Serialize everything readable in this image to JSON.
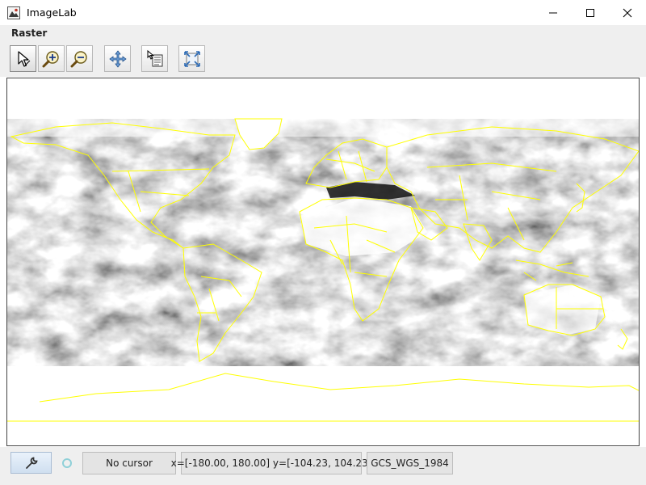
{
  "window": {
    "title": "ImageLab"
  },
  "menu": {
    "items": [
      "Raster"
    ]
  },
  "toolbar": {
    "buttons": [
      {
        "name": "select-tool",
        "icon": "select-pointer-icon"
      },
      {
        "name": "zoom-in",
        "icon": "zoom-in-icon"
      },
      {
        "name": "zoom-out",
        "icon": "zoom-out-icon"
      },
      {
        "name": "pan",
        "icon": "pan-arrows-icon"
      },
      {
        "name": "identify",
        "icon": "identify-info-icon"
      },
      {
        "name": "full-extent",
        "icon": "full-extent-icon"
      }
    ]
  },
  "map": {
    "layers": [
      "satellite cloud imagery (grayscale)",
      "country boundaries"
    ],
    "boundary_color": "#ffff00"
  },
  "status": {
    "cursor": "No cursor",
    "extent": "x=[-180.00, 180.00] y=[-104.23, 104.23]",
    "crs": "GCS_WGS_1984",
    "tool_icon": "wrench-icon",
    "loading_icon": "spinner-ring-icon"
  }
}
